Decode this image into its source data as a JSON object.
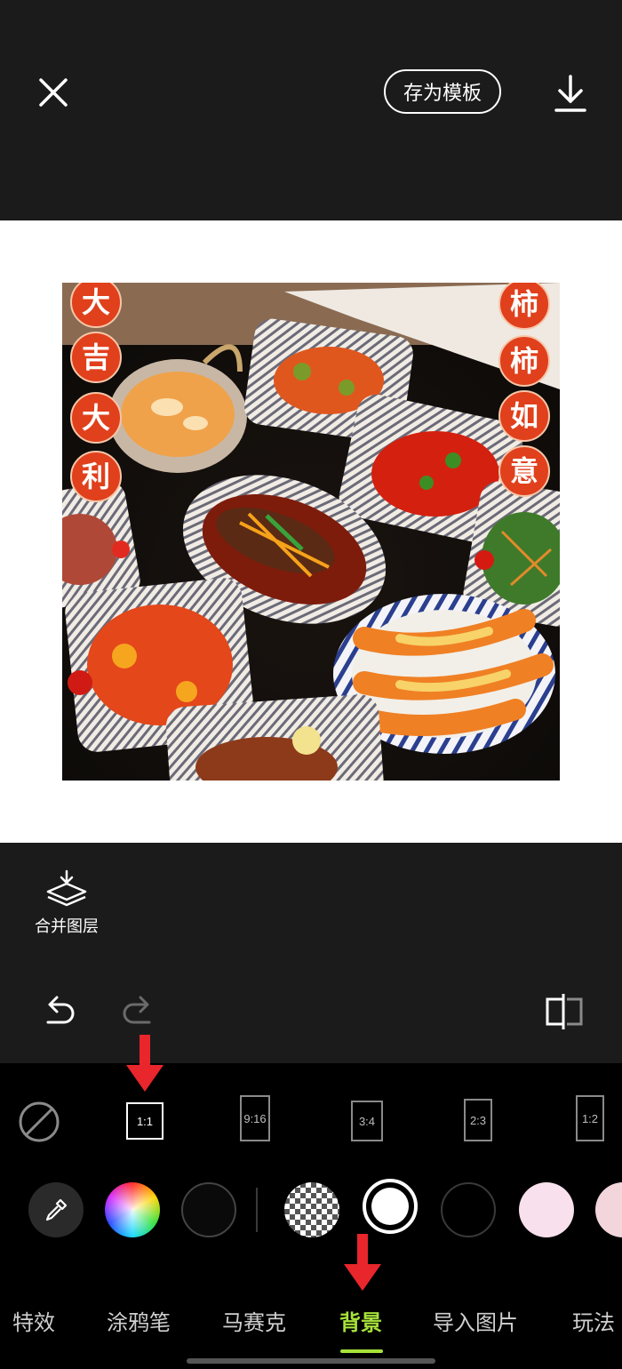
{
  "top_bar": {
    "save_template_label": "存为模板"
  },
  "photo": {
    "left_banner": [
      "大",
      "吉",
      "大",
      "利"
    ],
    "right_banner": [
      "柿",
      "柿",
      "如",
      "意"
    ]
  },
  "edit_area": {
    "merge_layers_label": "合并图层"
  },
  "ratios": [
    "1:1",
    "9:16",
    "3:4",
    "2:3",
    "1:2"
  ],
  "selected_ratio": "1:1",
  "swatches": {
    "selected": "white",
    "colors": [
      "#0a0a0a",
      "#ffffff",
      "#000000",
      "#f8e0ec",
      "#f2d6dc"
    ]
  },
  "tabs": [
    "特效",
    "涂鸦笔",
    "马赛克",
    "背景",
    "导入图片",
    "玩法"
  ],
  "active_tab": "背景",
  "colors": {
    "accent": "#a6e23a",
    "arrow": "#e8262b",
    "banner_red": "#e0401c"
  }
}
